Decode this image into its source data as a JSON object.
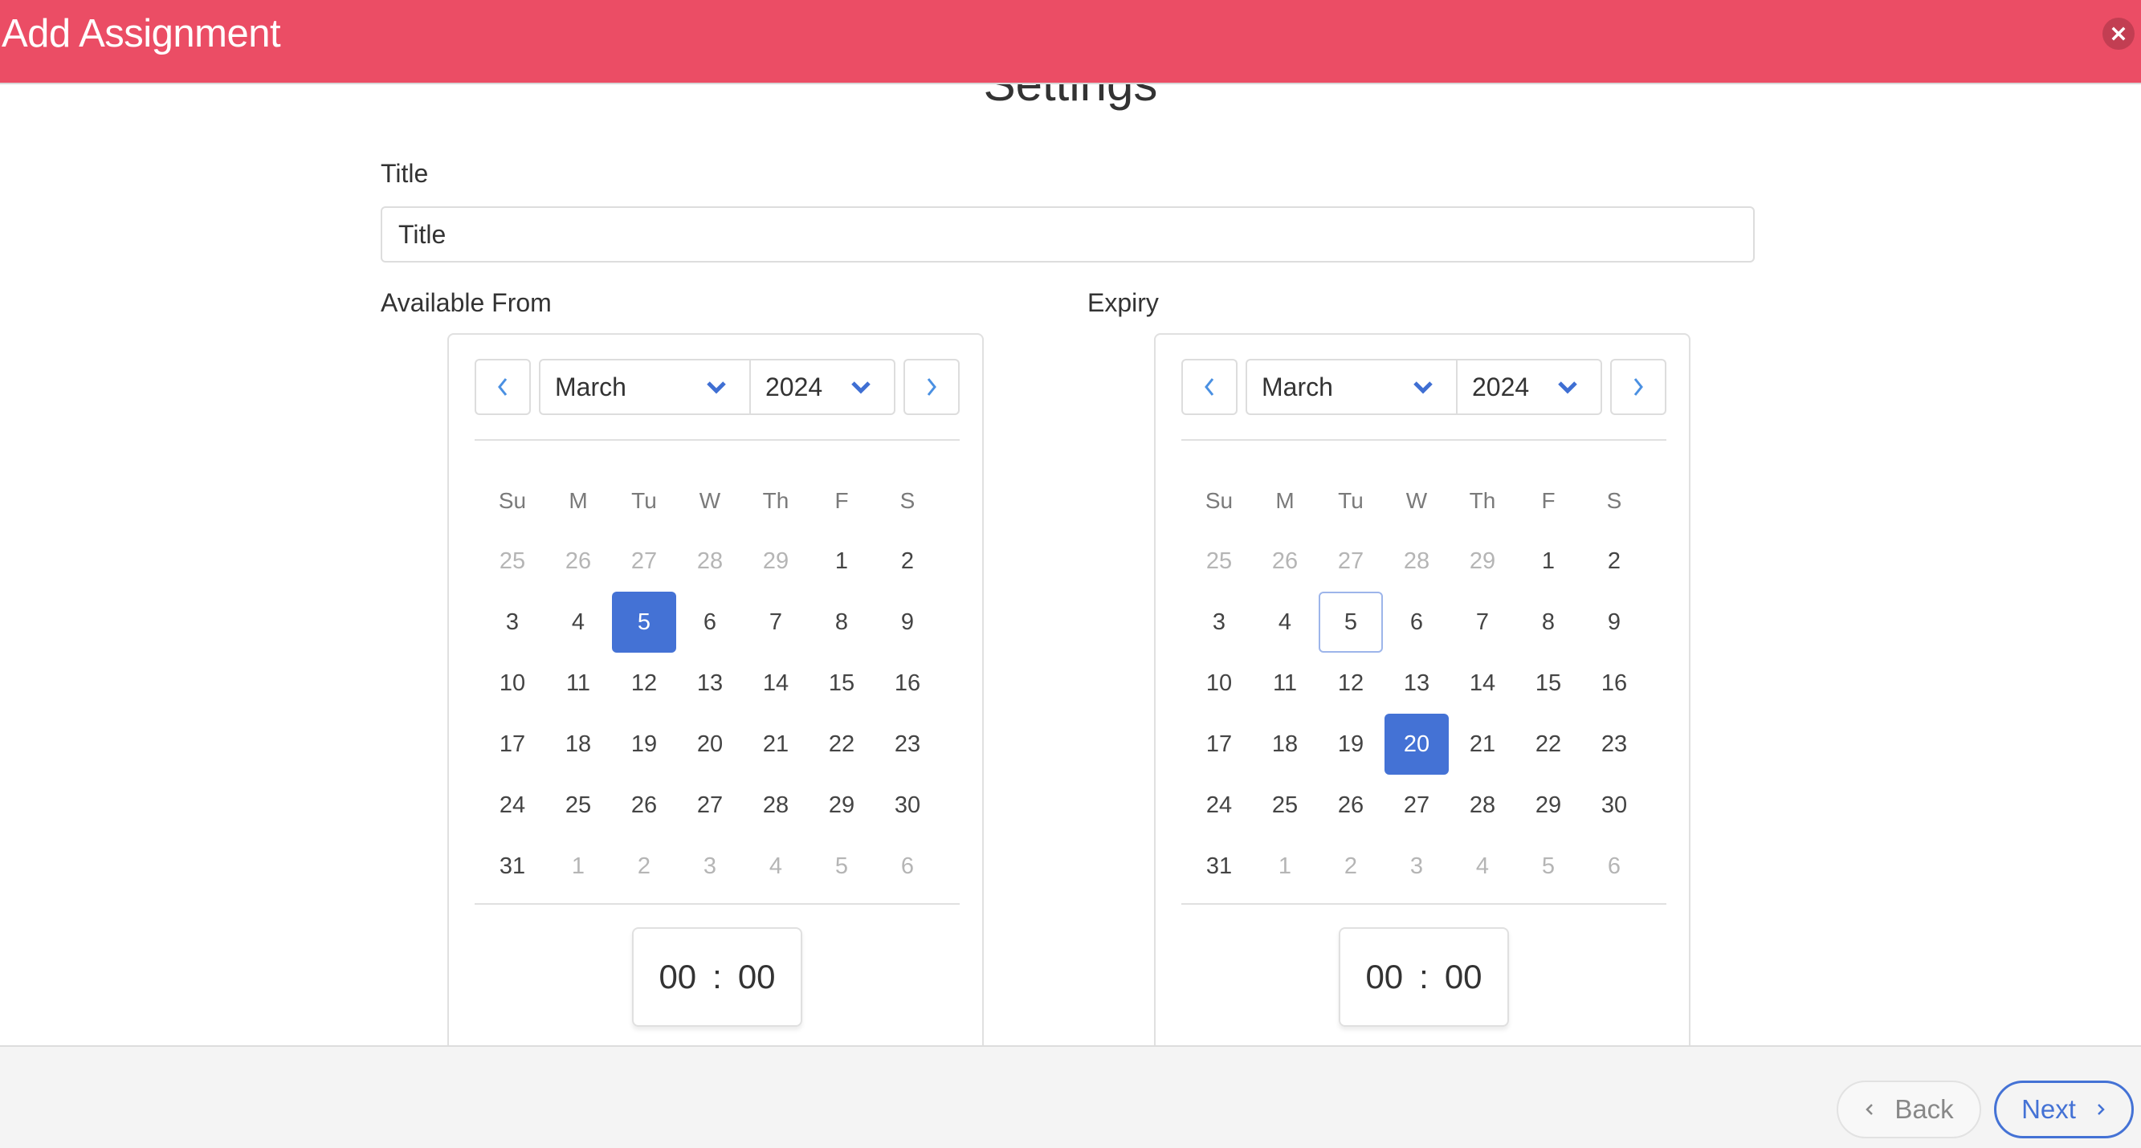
{
  "header": {
    "title": "Add Assignment",
    "close_icon": "close-icon",
    "background_color": "#EB4D65"
  },
  "main": {
    "section_heading": "Settings",
    "title_field": {
      "label": "Title",
      "value": "",
      "placeholder": "Title"
    },
    "available_from": {
      "label": "Available From",
      "month": "March",
      "year": "2024",
      "prev_icon": "chevron-left-icon",
      "next_icon": "chevron-right-icon",
      "weekdays": [
        "Su",
        "M",
        "Tu",
        "W",
        "Th",
        "F",
        "S"
      ],
      "days": [
        {
          "d": "25",
          "muted": true
        },
        {
          "d": "26",
          "muted": true
        },
        {
          "d": "27",
          "muted": true
        },
        {
          "d": "28",
          "muted": true
        },
        {
          "d": "29",
          "muted": true
        },
        {
          "d": "1"
        },
        {
          "d": "2"
        },
        {
          "d": "3"
        },
        {
          "d": "4"
        },
        {
          "d": "5",
          "selected": true
        },
        {
          "d": "6"
        },
        {
          "d": "7"
        },
        {
          "d": "8"
        },
        {
          "d": "9"
        },
        {
          "d": "10"
        },
        {
          "d": "11"
        },
        {
          "d": "12"
        },
        {
          "d": "13"
        },
        {
          "d": "14"
        },
        {
          "d": "15"
        },
        {
          "d": "16"
        },
        {
          "d": "17"
        },
        {
          "d": "18"
        },
        {
          "d": "19"
        },
        {
          "d": "20"
        },
        {
          "d": "21"
        },
        {
          "d": "22"
        },
        {
          "d": "23"
        },
        {
          "d": "24"
        },
        {
          "d": "25"
        },
        {
          "d": "26"
        },
        {
          "d": "27"
        },
        {
          "d": "28"
        },
        {
          "d": "29"
        },
        {
          "d": "30"
        },
        {
          "d": "31"
        },
        {
          "d": "1",
          "muted": true
        },
        {
          "d": "2",
          "muted": true
        },
        {
          "d": "3",
          "muted": true
        },
        {
          "d": "4",
          "muted": true
        },
        {
          "d": "5",
          "muted": true
        },
        {
          "d": "6",
          "muted": true
        }
      ],
      "time": {
        "hours": "00",
        "separator": ":",
        "minutes": "00"
      }
    },
    "expiry": {
      "label": "Expiry",
      "month": "March",
      "year": "2024",
      "prev_icon": "chevron-left-icon",
      "next_icon": "chevron-right-icon",
      "weekdays": [
        "Su",
        "M",
        "Tu",
        "W",
        "Th",
        "F",
        "S"
      ],
      "days": [
        {
          "d": "25",
          "muted": true
        },
        {
          "d": "26",
          "muted": true
        },
        {
          "d": "27",
          "muted": true
        },
        {
          "d": "28",
          "muted": true
        },
        {
          "d": "29",
          "muted": true
        },
        {
          "d": "1"
        },
        {
          "d": "2"
        },
        {
          "d": "3"
        },
        {
          "d": "4"
        },
        {
          "d": "5",
          "today": true
        },
        {
          "d": "6"
        },
        {
          "d": "7"
        },
        {
          "d": "8"
        },
        {
          "d": "9"
        },
        {
          "d": "10"
        },
        {
          "d": "11"
        },
        {
          "d": "12"
        },
        {
          "d": "13"
        },
        {
          "d": "14"
        },
        {
          "d": "15"
        },
        {
          "d": "16"
        },
        {
          "d": "17"
        },
        {
          "d": "18"
        },
        {
          "d": "19"
        },
        {
          "d": "20",
          "selected": true
        },
        {
          "d": "21"
        },
        {
          "d": "22"
        },
        {
          "d": "23"
        },
        {
          "d": "24"
        },
        {
          "d": "25"
        },
        {
          "d": "26"
        },
        {
          "d": "27"
        },
        {
          "d": "28"
        },
        {
          "d": "29"
        },
        {
          "d": "30"
        },
        {
          "d": "31"
        },
        {
          "d": "1",
          "muted": true
        },
        {
          "d": "2",
          "muted": true
        },
        {
          "d": "3",
          "muted": true
        },
        {
          "d": "4",
          "muted": true
        },
        {
          "d": "5",
          "muted": true
        },
        {
          "d": "6",
          "muted": true
        }
      ],
      "time": {
        "hours": "00",
        "separator": ":",
        "minutes": "00"
      }
    }
  },
  "footer": {
    "back_label": "Back",
    "next_label": "Next",
    "accent_color": "#4472D5"
  }
}
